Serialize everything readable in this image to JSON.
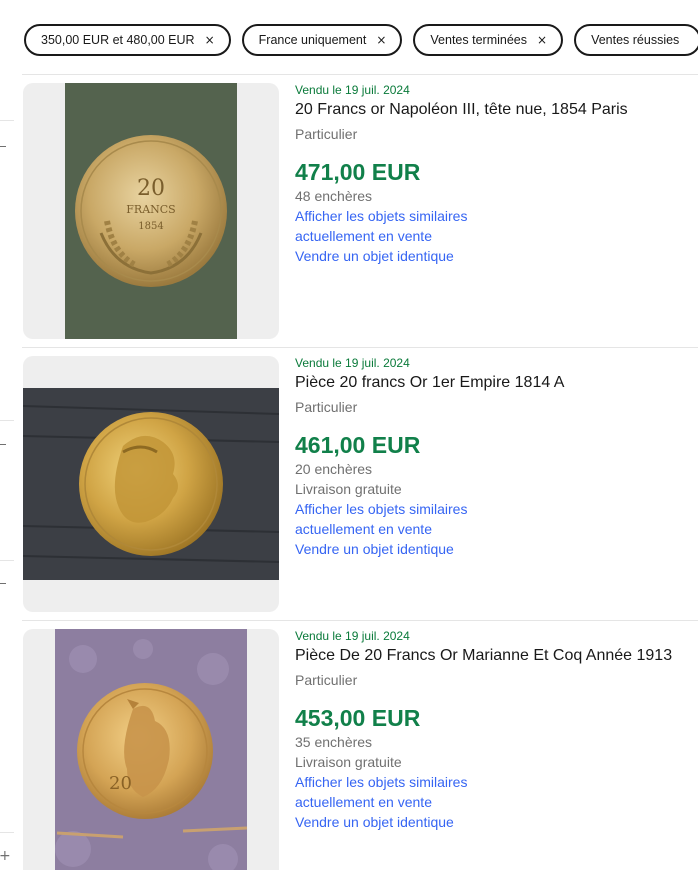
{
  "filters": [
    {
      "label": "350,00 EUR et 480,00 EUR",
      "remove": "×"
    },
    {
      "label": "France uniquement",
      "remove": "×"
    },
    {
      "label": "Ventes terminées",
      "remove": "×"
    },
    {
      "label": "Ventes réussies",
      "remove": ""
    }
  ],
  "rail": {
    "plus": "+"
  },
  "items": [
    {
      "sold": "Vendu le 19 juil. 2024",
      "title": "20 Francs or Napoléon III, tête nue, 1854 Paris",
      "seller": "Particulier",
      "price": "471,00 EUR",
      "bids": "48 enchères",
      "shipping": "",
      "similar_1": "Afficher les objets similaires",
      "similar_2": "actuellement en vente",
      "sell_similar": "Vendre un objet identique",
      "coin_text": "20 FRANCS 1854"
    },
    {
      "sold": "Vendu le 19 juil. 2024",
      "title": "Pièce 20 francs Or 1er Empire 1814 A",
      "seller": "Particulier",
      "price": "461,00 EUR",
      "bids": "20 enchères",
      "shipping": "Livraison gratuite",
      "similar_1": "Afficher les objets similaires",
      "similar_2": "actuellement en vente",
      "sell_similar": "Vendre un objet identique"
    },
    {
      "sold": "Vendu le 19 juil. 2024",
      "title": "Pièce De 20 Francs Or Marianne Et Coq Année 1913",
      "seller": "Particulier",
      "price": "453,00 EUR",
      "bids": "35 enchères",
      "shipping": "Livraison gratuite",
      "similar_1": "Afficher les objets similaires",
      "similar_2": "actuellement en vente",
      "sell_similar": "Vendre un objet identique"
    }
  ],
  "colors": {
    "sold": "#0a7a3a",
    "price": "#11804a",
    "link": "#3665f3"
  }
}
